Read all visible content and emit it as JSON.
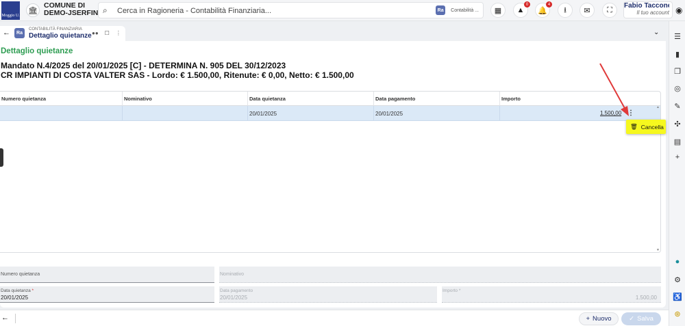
{
  "header": {
    "logo_text": "Moggio U.",
    "org_line1": "COMUNE DI",
    "org_line2": "DEMO-JSERFIN",
    "search_placeholder": "Cerca in Ragioneria - Contabilità Finanziaria...",
    "module_badge": "Ra",
    "module_label": "Contabilità ...",
    "alerts_count": "0",
    "notifications_count": "4",
    "user_name": "Fabio Taccone...",
    "user_account": "Il tuo account"
  },
  "tab": {
    "badge": "Ra",
    "module": "CONTABILITÀ FINANZIARIA",
    "title": "Dettaglio quietanze"
  },
  "page": {
    "title": "Dettaglio quietanze",
    "headline_line1": "Mandato N.4/2025 del 20/01/2025 [C] - DETERMINA N. 905 DEL 30/12/2023",
    "headline_line2": "CR IMPIANTI DI COSTA VALTER SAS - Lordo: € 1.500,00, Ritenute: € 0,00, Netto: € 1.500,00"
  },
  "grid": {
    "columns": [
      "Numero quietanza",
      "Nominativo",
      "Data quietanza",
      "Data pagamento",
      "Importo"
    ],
    "rows": [
      {
        "numero": "",
        "nominativo": "",
        "data_quietanza": "20/01/2025",
        "data_pagamento": "20/01/2025",
        "importo": "1.500,00"
      }
    ]
  },
  "context_menu": {
    "delete_label": "Cancella"
  },
  "form": {
    "numero_label": "Numero quietanza",
    "nominativo_label": "Nominativo",
    "data_quietanza_label": "Data quietanza",
    "data_quietanza_value": "20/01/2025",
    "data_pagamento_label": "Data pagamento",
    "data_pagamento_value": "20/01/2025",
    "importo_label": "Importo",
    "importo_value": "1.500,00"
  },
  "footer": {
    "new_label": "Nuovo",
    "save_label": "Salva"
  },
  "colors": {
    "accent_green": "#2e9d52",
    "brand_blue": "#1d2d6b",
    "selected_row": "#dbe9f7",
    "highlight_yellow": "#f6f81e",
    "annotation_red": "#e03a3a"
  }
}
